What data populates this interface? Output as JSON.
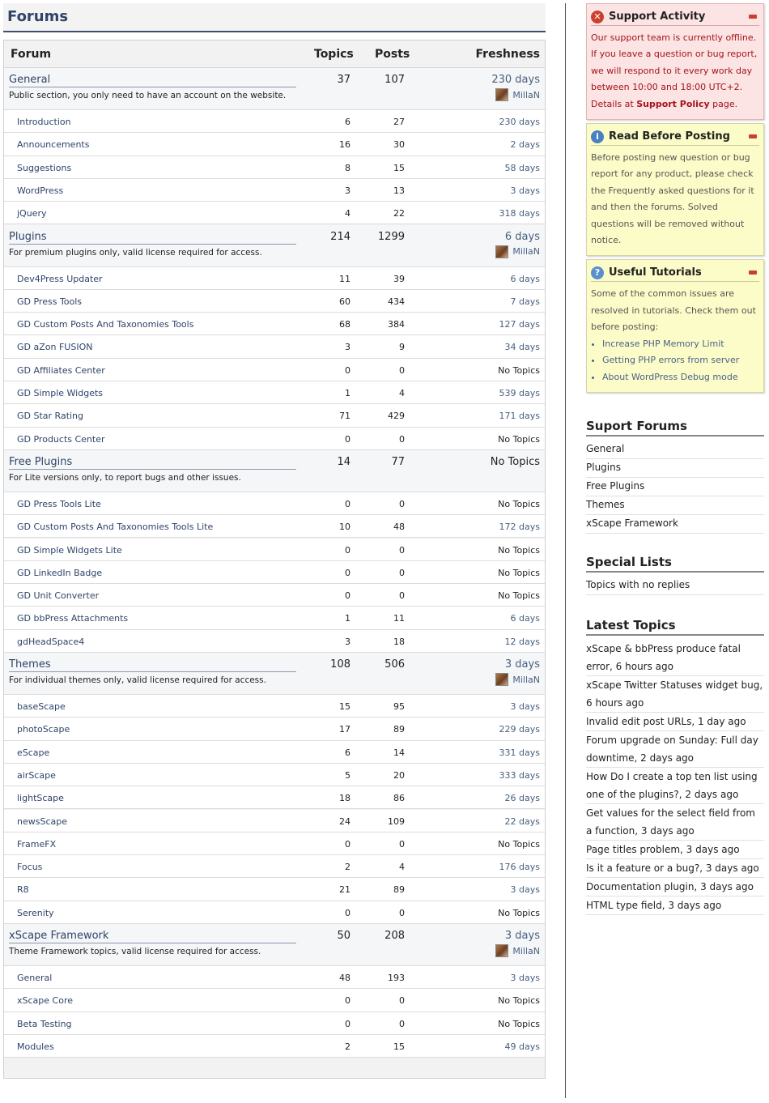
{
  "page_title": "Forums",
  "table": {
    "col_forum": "Forum",
    "col_topics": "Topics",
    "col_posts": "Posts",
    "col_freshness": "Freshness"
  },
  "groups": [
    {
      "name": "General",
      "desc": "Public section, you only need to have an account on the website.",
      "topics": "37",
      "posts": "107",
      "freshness": "230 days",
      "author": "MillaN",
      "children": [
        {
          "name": "Introduction",
          "topics": "6",
          "posts": "27",
          "freshness": "230 days"
        },
        {
          "name": "Announcements",
          "topics": "16",
          "posts": "30",
          "freshness": "2 days"
        },
        {
          "name": "Suggestions",
          "topics": "8",
          "posts": "15",
          "freshness": "58 days"
        },
        {
          "name": "WordPress",
          "topics": "3",
          "posts": "13",
          "freshness": "3 days"
        },
        {
          "name": "jQuery",
          "topics": "4",
          "posts": "22",
          "freshness": "318 days"
        }
      ]
    },
    {
      "name": "Plugins",
      "desc": "For premium plugins only, valid license required for access.",
      "topics": "214",
      "posts": "1299",
      "freshness": "6 days",
      "author": "MillaN",
      "children": [
        {
          "name": "Dev4Press Updater",
          "topics": "11",
          "posts": "39",
          "freshness": "6 days"
        },
        {
          "name": "GD Press Tools",
          "topics": "60",
          "posts": "434",
          "freshness": "7 days"
        },
        {
          "name": "GD Custom Posts And Taxonomies Tools",
          "topics": "68",
          "posts": "384",
          "freshness": "127 days"
        },
        {
          "name": "GD aZon FUSION",
          "topics": "3",
          "posts": "9",
          "freshness": "34 days"
        },
        {
          "name": "GD Affiliates Center",
          "topics": "0",
          "posts": "0",
          "freshness": "No Topics"
        },
        {
          "name": "GD Simple Widgets",
          "topics": "1",
          "posts": "4",
          "freshness": "539 days"
        },
        {
          "name": "GD Star Rating",
          "topics": "71",
          "posts": "429",
          "freshness": "171 days"
        },
        {
          "name": "GD Products Center",
          "topics": "0",
          "posts": "0",
          "freshness": "No Topics"
        }
      ]
    },
    {
      "name": "Free Plugins",
      "desc": "For Lite versions only, to report bugs and other issues.",
      "topics": "14",
      "posts": "77",
      "freshness": "No Topics",
      "author": "",
      "children": [
        {
          "name": "GD Press Tools Lite",
          "topics": "0",
          "posts": "0",
          "freshness": "No Topics"
        },
        {
          "name": "GD Custom Posts And Taxonomies Tools Lite",
          "topics": "10",
          "posts": "48",
          "freshness": "172 days"
        },
        {
          "name": "GD Simple Widgets Lite",
          "topics": "0",
          "posts": "0",
          "freshness": "No Topics"
        },
        {
          "name": "GD LinkedIn Badge",
          "topics": "0",
          "posts": "0",
          "freshness": "No Topics"
        },
        {
          "name": "GD Unit Converter",
          "topics": "0",
          "posts": "0",
          "freshness": "No Topics"
        },
        {
          "name": "GD bbPress Attachments",
          "topics": "1",
          "posts": "11",
          "freshness": "6 days"
        },
        {
          "name": "gdHeadSpace4",
          "topics": "3",
          "posts": "18",
          "freshness": "12 days"
        }
      ]
    },
    {
      "name": "Themes",
      "desc": "For individual themes only, valid license required for access.",
      "topics": "108",
      "posts": "506",
      "freshness": "3 days",
      "author": "MillaN",
      "children": [
        {
          "name": "baseScape",
          "topics": "15",
          "posts": "95",
          "freshness": "3 days"
        },
        {
          "name": "photoScape",
          "topics": "17",
          "posts": "89",
          "freshness": "229 days"
        },
        {
          "name": "eScape",
          "topics": "6",
          "posts": "14",
          "freshness": "331 days"
        },
        {
          "name": "airScape",
          "topics": "5",
          "posts": "20",
          "freshness": "333 days"
        },
        {
          "name": "lightScape",
          "topics": "18",
          "posts": "86",
          "freshness": "26 days"
        },
        {
          "name": "newsScape",
          "topics": "24",
          "posts": "109",
          "freshness": "22 days"
        },
        {
          "name": "FrameFX",
          "topics": "0",
          "posts": "0",
          "freshness": "No Topics"
        },
        {
          "name": "Focus",
          "topics": "2",
          "posts": "4",
          "freshness": "176 days"
        },
        {
          "name": "R8",
          "topics": "21",
          "posts": "89",
          "freshness": "3 days"
        },
        {
          "name": "Serenity",
          "topics": "0",
          "posts": "0",
          "freshness": "No Topics"
        }
      ]
    },
    {
      "name": "xScape Framework",
      "desc": "Theme Framework topics, valid license required for access.",
      "topics": "50",
      "posts": "208",
      "freshness": "3 days",
      "author": "MillaN",
      "children": [
        {
          "name": "General",
          "topics": "48",
          "posts": "193",
          "freshness": "3 days"
        },
        {
          "name": "xScape Core",
          "topics": "0",
          "posts": "0",
          "freshness": "No Topics"
        },
        {
          "name": "Beta Testing",
          "topics": "0",
          "posts": "0",
          "freshness": "No Topics"
        },
        {
          "name": "Modules",
          "topics": "2",
          "posts": "15",
          "freshness": "49 days"
        }
      ]
    }
  ],
  "sidebar": {
    "support_activity": {
      "title": "Support Activity",
      "text": "Our support team is currently offline. If you leave a question or bug report, we will respond to it every work day between 10:00 and 18:00 UTC+2. Details at ",
      "link": "Support Policy",
      "text_end": " page."
    },
    "read_before": {
      "title": "Read Before Posting",
      "text": "Before posting new question or bug report for any product, please check the Frequently asked questions for it and then the forums. Solved questions will be removed without notice."
    },
    "tutorials": {
      "title": "Useful Tutorials",
      "text": "Some of the common issues are resolved in tutorials. Check them out before posting:",
      "items": [
        "Increase PHP Memory Limit",
        "Getting PHP errors from server",
        "About WordPress Debug mode"
      ]
    },
    "support_forums": {
      "title": "Suport Forums",
      "items": [
        "General",
        "Plugins",
        "Free Plugins",
        "Themes",
        "xScape Framework"
      ]
    },
    "special_lists": {
      "title": "Special Lists",
      "items": [
        "Topics with no replies"
      ]
    },
    "latest_topics": {
      "title": "Latest Topics",
      "items": [
        "xScape & bbPress produce fatal error, 6 hours ago",
        "xScape Twitter Statuses widget bug, 6 hours ago",
        "Invalid edit post URLs, 1 day ago",
        "Forum upgrade on Sunday: Full day downtime, 2 days ago",
        "How Do I create a top ten list using one of the plugins?, 2 days ago",
        "Get values for the select field from a function, 3 days ago",
        "Page titles problem, 3 days ago",
        "Is it a feature or a bug?, 3 days ago",
        "Documentation plugin, 3 days ago",
        "HTML type field, 3 days ago"
      ]
    }
  }
}
